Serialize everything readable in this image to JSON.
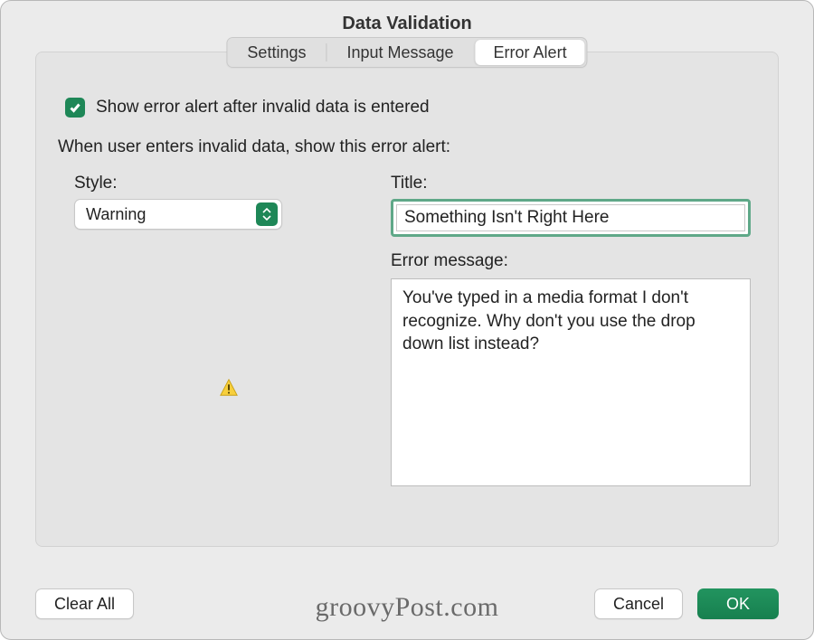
{
  "window": {
    "title": "Data Validation"
  },
  "tabs": {
    "settings": "Settings",
    "input_message": "Input Message",
    "error_alert": "Error Alert"
  },
  "checkbox": {
    "checked": true,
    "label": "Show error alert after invalid data is entered"
  },
  "instruction": "When user enters invalid data, show this error alert:",
  "style": {
    "label": "Style:",
    "value": "Warning"
  },
  "title_field": {
    "label": "Title:",
    "value": "Something Isn't Right Here"
  },
  "error_message": {
    "label": "Error message:",
    "value": "You've typed in a media format I don't recognize. Why don't you use the drop down list instead?"
  },
  "buttons": {
    "clear_all": "Clear All",
    "cancel": "Cancel",
    "ok": "OK"
  },
  "watermark": "groovyPost.com",
  "colors": {
    "accent": "#1e8757"
  }
}
